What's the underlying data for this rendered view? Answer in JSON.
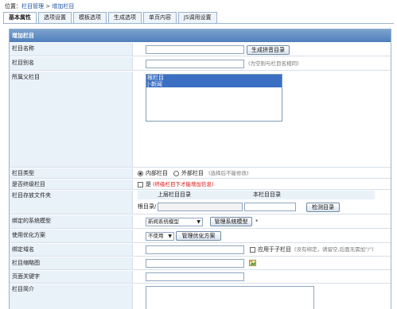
{
  "breadcrumb": {
    "prefix": "位置：",
    "section": "栏目管理",
    "separator": " > ",
    "current": "增加栏目"
  },
  "tabs": [
    "基本属性",
    "选项设置",
    "模板选项",
    "生成选项",
    "单页内容",
    "JS调用设置"
  ],
  "panel_title": "增加栏目",
  "fields": {
    "name": {
      "label": "栏目名称",
      "button": "生成拼音目录"
    },
    "alias": {
      "label": "栏目别名",
      "hint": "(为空则与栏目名相同)"
    },
    "parent": {
      "label": "所属父栏目",
      "options": [
        "根栏目",
        "|-新闻"
      ]
    },
    "type": {
      "label": "栏目类型",
      "option_inner": "内部栏目",
      "option_outer": "外部栏目",
      "outer_hint": "(选择后不能修改)"
    },
    "final": {
      "label": "是否终级栏目",
      "checkbox_label": "是",
      "hint": "(终级栏目下才能增加信息)"
    },
    "folder": {
      "label": "栏目存放文件夹",
      "col_parent": "上层栏目目录",
      "col_current": "本栏目目录",
      "prefix": "根目录/",
      "button": "检测目录"
    },
    "model": {
      "label": "绑定的系统模型",
      "selected": "新闻系统模型",
      "button": "管理系统模型",
      "required": "*"
    },
    "optimize": {
      "label": "使用优化方案",
      "selected": "不使用",
      "button": "管理优化方案"
    },
    "domain": {
      "label": "绑定域名",
      "checkbox_label": "应用于子栏目",
      "hint": "(没有绑定，请留空,后面无需加\"/\")"
    },
    "thumb": {
      "label": "栏目缩略图"
    },
    "keywords": {
      "label": "页面关键字"
    },
    "intro": {
      "label": "栏目简介"
    }
  },
  "colors": {
    "header": "#4f7fbb",
    "label_bg": "#e9f1f9",
    "accent": "#1a4f9c",
    "warning": "#dd1111"
  }
}
